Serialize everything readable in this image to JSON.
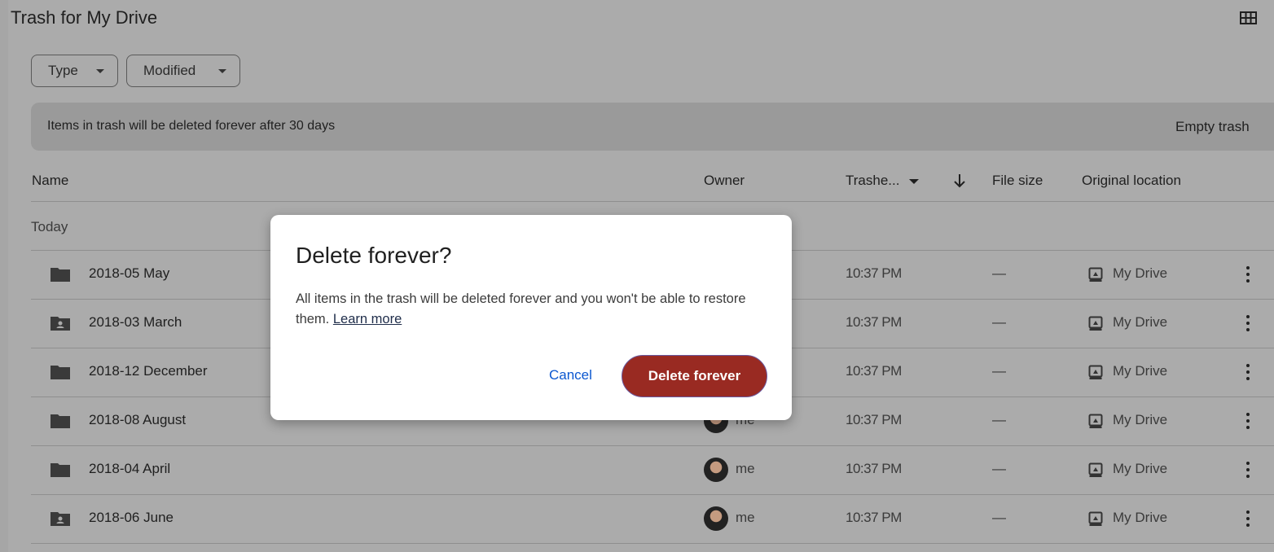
{
  "header": {
    "title": "Trash for My Drive",
    "view_icon": "grid-view-icon"
  },
  "filters": [
    {
      "label": "Type"
    },
    {
      "label": "Modified"
    }
  ],
  "banner": {
    "message": "Items in trash will be deleted forever after 30 days",
    "action": "Empty trash"
  },
  "columns": {
    "name": "Name",
    "owner": "Owner",
    "trashed": "Trashe...",
    "file_size": "File size",
    "original_location": "Original location"
  },
  "group_label": "Today",
  "rows": [
    {
      "name": "2018-05 May",
      "icon": "folder-icon",
      "owner": "",
      "trashed": "10:37 PM",
      "size": "—",
      "location": "My Drive"
    },
    {
      "name": "2018-03 March",
      "icon": "shared-folder-icon",
      "owner": "",
      "trashed": "10:37 PM",
      "size": "—",
      "location": "My Drive"
    },
    {
      "name": "2018-12 December",
      "icon": "folder-icon",
      "owner": "",
      "trashed": "10:37 PM",
      "size": "—",
      "location": "My Drive"
    },
    {
      "name": "2018-08 August",
      "icon": "folder-icon",
      "owner": "me",
      "trashed": "10:37 PM",
      "size": "—",
      "location": "My Drive"
    },
    {
      "name": "2018-04 April",
      "icon": "folder-icon",
      "owner": "me",
      "trashed": "10:37 PM",
      "size": "—",
      "location": "My Drive"
    },
    {
      "name": "2018-06 June",
      "icon": "shared-folder-icon",
      "owner": "me",
      "trashed": "10:37 PM",
      "size": "—",
      "location": "My Drive"
    }
  ],
  "dialog": {
    "title": "Delete forever?",
    "body": "All items in the trash will be deleted forever and you won't be able to restore them.",
    "link": "Learn more",
    "cancel": "Cancel",
    "confirm": "Delete forever",
    "confirm_color": "#992a22"
  }
}
